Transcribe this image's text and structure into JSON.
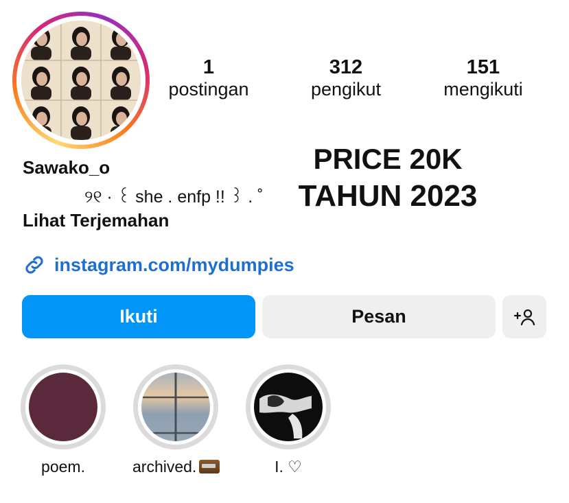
{
  "profile": {
    "username": "Sawako_o",
    "bio": "୨୧ · ꒰ she . enfp !! ꒱ . ˚",
    "translate_label": "Lihat Terjemahan",
    "link": "instagram.com/mydumpies"
  },
  "stats": {
    "posts": {
      "value": "1",
      "label": "postingan"
    },
    "followers": {
      "value": "312",
      "label": "pengikut"
    },
    "following": {
      "value": "151",
      "label": "mengikuti"
    }
  },
  "overlay_text": {
    "line1": "PRICE 20K",
    "line2": "TAHUN 2023"
  },
  "buttons": {
    "follow": "Ikuti",
    "message": "Pesan",
    "add_user": "+👤"
  },
  "highlights": [
    {
      "label": "poem."
    },
    {
      "label": "archived."
    },
    {
      "label": "I. ♡"
    }
  ],
  "colors": {
    "primary_button": "#0095f6",
    "secondary_button": "#efefef",
    "link": "#1f6fd1",
    "highlight_ring": "#dbdbdb"
  }
}
